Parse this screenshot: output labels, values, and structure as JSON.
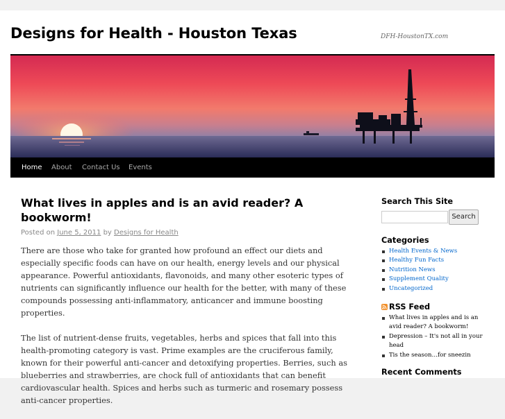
{
  "header": {
    "site_title": "Designs for Health - Houston Texas",
    "site_description": "DFH-HoustonTX.com"
  },
  "nav": {
    "items": [
      {
        "label": "Home",
        "current": true
      },
      {
        "label": "About",
        "current": false
      },
      {
        "label": "Contact Us",
        "current": false
      },
      {
        "label": "Events",
        "current": false
      }
    ]
  },
  "post": {
    "title": "What lives in apples and is an avid reader? A bookworm!",
    "meta_prefix": "Posted on",
    "date": "June 5, 2011",
    "meta_by": "by",
    "author": "Designs for Health",
    "paragraphs": [
      "There are those who take for granted how profound an effect our diets and especially specific foods can have on our health, energy levels and our physical appearance. Powerful antioxidants, flavonoids, and many other esoteric types of nutrients can significantly influence our health for the better, with many of these compounds possessing anti-inflammatory, anticancer and immune boosting properties.",
      "The list of nutrient-dense fruits, vegetables, herbs and spices that fall into this health-promoting category is vast.  Prime examples are the cruciferous family, known for their powerful anti-cancer and detoxifying properties. Berries, such as blueberries and strawberries, are chock full of antioxidants that can benefit cardiovascular health. Spices and herbs such as turmeric and rosemary possess anti-cancer properties."
    ]
  },
  "sidebar": {
    "search": {
      "title": "Search This Site",
      "value": "",
      "button_label": "Search"
    },
    "categories": {
      "title": "Categories",
      "items": [
        "Health Events & News",
        "Healthy Fun Facts",
        "Nutrition News",
        "Supplement Quality",
        "Uncategorized"
      ]
    },
    "rss": {
      "title": "RSS Feed",
      "items": [
        "What lives in apples and is an avid reader? A bookworm!",
        "Depression – It's not all in your head",
        "Tis the season…for sneezin"
      ]
    },
    "recent_comments": {
      "title": "Recent Comments"
    }
  },
  "colors": {
    "nav_bg": "#000000",
    "link": "#0066cc",
    "rss_orange": "#f18f2a"
  }
}
